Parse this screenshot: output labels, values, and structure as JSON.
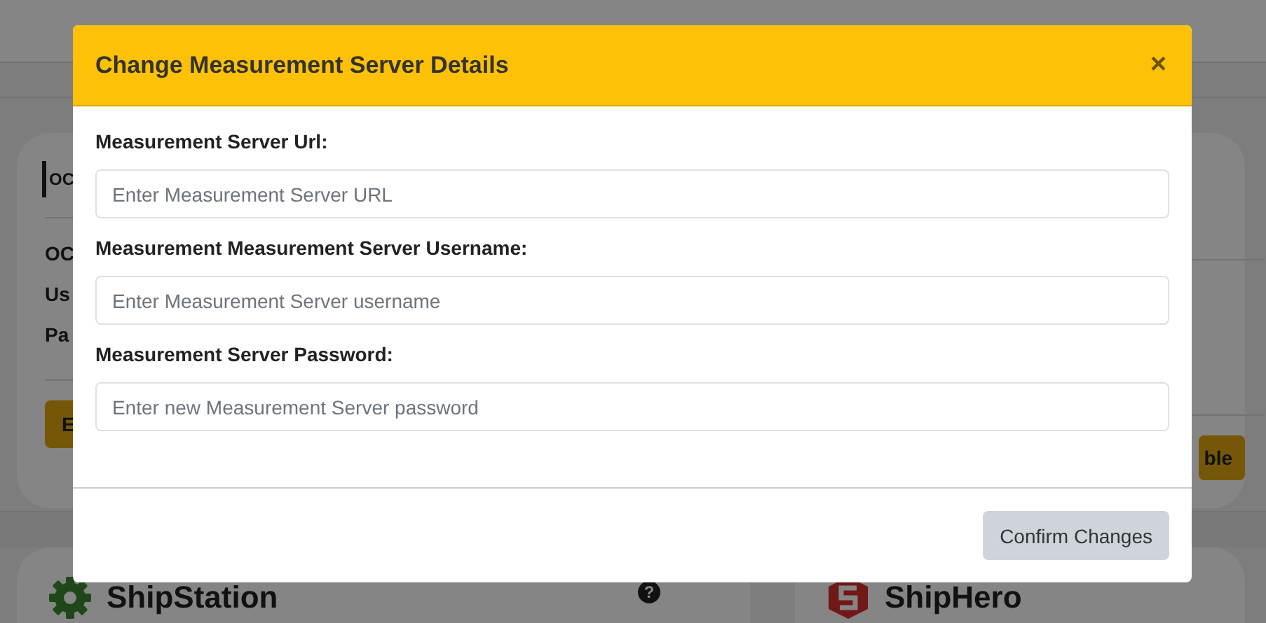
{
  "page": {
    "top_card": {
      "logo_text": "OC",
      "fields": [
        "OC",
        "Us",
        "Pa"
      ],
      "button": "E"
    },
    "right_card": {
      "button": "ble"
    },
    "integrations": [
      {
        "name": "ShipStation",
        "kind": "gear",
        "help": "?"
      },
      {
        "name": "ShipHero",
        "kind": "shield"
      }
    ]
  },
  "modal": {
    "title": "Change Measurement Server Details",
    "close": "×",
    "fields": [
      {
        "label": "Measurement Server Url:",
        "placeholder": "Enter Measurement Server URL"
      },
      {
        "label": "Measurement Measurement Server Username:",
        "placeholder": "Enter Measurement Server username"
      },
      {
        "label": "Measurement Server Password:",
        "placeholder": "Enter new Measurement Server password"
      }
    ],
    "button": "Confirm Changes"
  }
}
